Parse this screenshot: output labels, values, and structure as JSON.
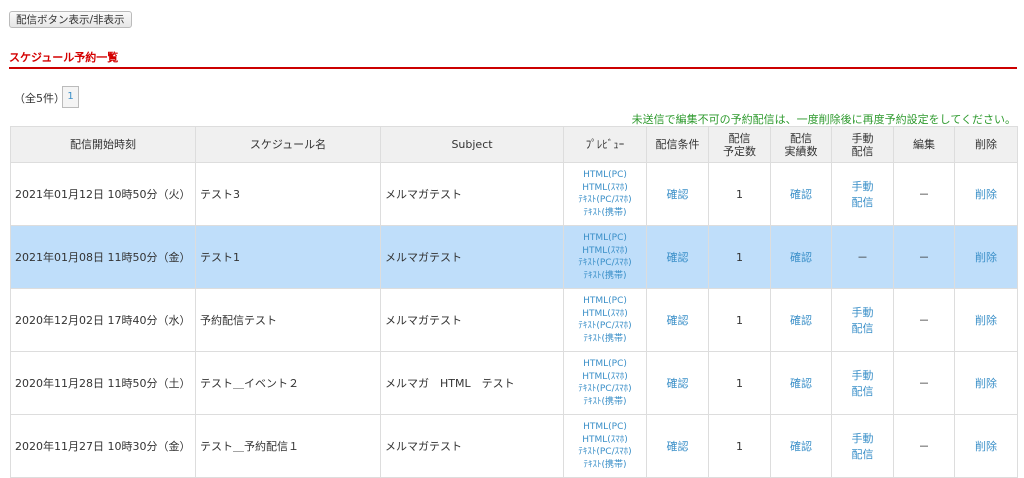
{
  "toggle_button": "配信ボタン表示/非表示",
  "section_title": "スケジュール予約一覧",
  "total_count": "（全5件）",
  "pagination": [
    "1"
  ],
  "notice": "未送信で編集不可の予約配信は、一度削除後に再度予約設定をしてください。",
  "headers": {
    "start": "配信開始時刻",
    "name": "スケジュール名",
    "subject": "Subject",
    "preview": "ﾌﾟﾚﾋﾞｭｰ",
    "condition": "配信条件",
    "planned_1": "配信",
    "planned_2": "予定数",
    "actual_1": "配信",
    "actual_2": "実績数",
    "manual_1": "手動",
    "manual_2": "配信",
    "edit": "編集",
    "delete": "削除"
  },
  "preview_links": [
    "HTML(PC)",
    "HTML(ｽﾏﾎ)",
    "ﾃｷｽﾄ(PC/ｽﾏﾎ)",
    "ﾃｷｽﾄ(携帯)"
  ],
  "labels": {
    "confirm": "確認",
    "manual_1": "手動",
    "manual_2": "配信",
    "dash": "－",
    "delete": "削除"
  },
  "rows": [
    {
      "start": "2021年01月12日 10時50分（火）",
      "name": "テスト3",
      "subject": "メルマガテスト",
      "planned": "1",
      "manual": true,
      "selected": false
    },
    {
      "start": "2021年01月08日 11時50分（金）",
      "name": "テスト1",
      "subject": "メルマガテスト",
      "planned": "1",
      "manual": false,
      "selected": true
    },
    {
      "start": "2020年12月02日 17時40分（水）",
      "name": "予約配信テスト",
      "subject": "メルマガテスト",
      "planned": "1",
      "manual": true,
      "selected": false
    },
    {
      "start": "2020年11月28日 11時50分（土）",
      "name": "テスト＿イベント２",
      "subject": "メルマガ　HTML　テスト",
      "planned": "1",
      "manual": true,
      "selected": false
    },
    {
      "start": "2020年11月27日 10時30分（金）",
      "name": "テスト＿予約配信１",
      "subject": "メルマガテスト",
      "planned": "1",
      "manual": true,
      "selected": false
    }
  ]
}
